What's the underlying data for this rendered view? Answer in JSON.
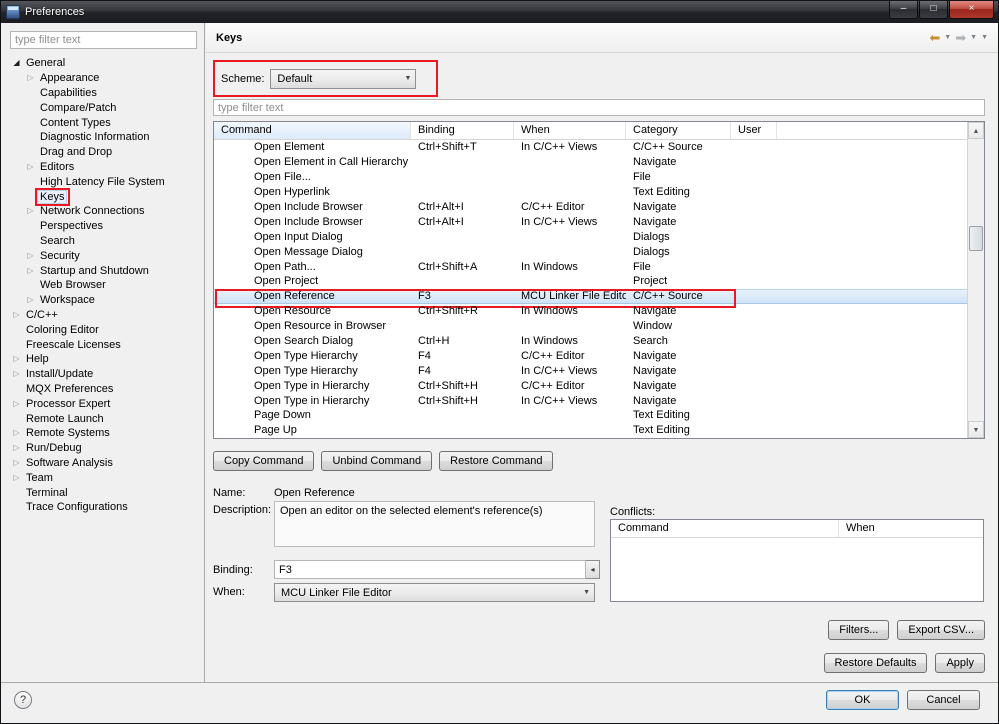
{
  "colors": {
    "annotation": "#e8191f",
    "selection": "#cfe3f7"
  },
  "window": {
    "title": "Preferences",
    "minimize": "–",
    "maximize": "□",
    "close": "×"
  },
  "icons": {
    "back": "⬅",
    "forward": "➡",
    "caret": "▼",
    "scroll_up": "▲",
    "scroll_down": "▼",
    "combo_arrow": "▼",
    "binding_more": "◂",
    "help": "?"
  },
  "sidebar": {
    "filter_placeholder": "type filter text",
    "tree": [
      {
        "label": "General",
        "level": 0,
        "arrow": "expanded"
      },
      {
        "label": "Appearance",
        "level": 1,
        "arrow": "collapsed"
      },
      {
        "label": "Capabilities",
        "level": 1,
        "arrow": "none"
      },
      {
        "label": "Compare/Patch",
        "level": 1,
        "arrow": "none"
      },
      {
        "label": "Content Types",
        "level": 1,
        "arrow": "none"
      },
      {
        "label": "Diagnostic Information",
        "level": 1,
        "arrow": "none"
      },
      {
        "label": "Drag and Drop",
        "level": 1,
        "arrow": "none"
      },
      {
        "label": "Editors",
        "level": 1,
        "arrow": "collapsed"
      },
      {
        "label": "High Latency File System",
        "level": 1,
        "arrow": "none"
      },
      {
        "label": "Keys",
        "level": 1,
        "arrow": "none",
        "selected": true,
        "annotated": true
      },
      {
        "label": "Network Connections",
        "level": 1,
        "arrow": "collapsed"
      },
      {
        "label": "Perspectives",
        "level": 1,
        "arrow": "none"
      },
      {
        "label": "Search",
        "level": 1,
        "arrow": "none"
      },
      {
        "label": "Security",
        "level": 1,
        "arrow": "collapsed"
      },
      {
        "label": "Startup and Shutdown",
        "level": 1,
        "arrow": "collapsed"
      },
      {
        "label": "Web Browser",
        "level": 1,
        "arrow": "none"
      },
      {
        "label": "Workspace",
        "level": 1,
        "arrow": "collapsed"
      },
      {
        "label": "C/C++",
        "level": 0,
        "arrow": "collapsed"
      },
      {
        "label": "Coloring Editor",
        "level": 0,
        "arrow": "none"
      },
      {
        "label": "Freescale Licenses",
        "level": 0,
        "arrow": "none"
      },
      {
        "label": "Help",
        "level": 0,
        "arrow": "collapsed"
      },
      {
        "label": "Install/Update",
        "level": 0,
        "arrow": "collapsed"
      },
      {
        "label": "MQX Preferences",
        "level": 0,
        "arrow": "none"
      },
      {
        "label": "Processor Expert",
        "level": 0,
        "arrow": "collapsed"
      },
      {
        "label": "Remote Launch",
        "level": 0,
        "arrow": "none"
      },
      {
        "label": "Remote Systems",
        "level": 0,
        "arrow": "collapsed"
      },
      {
        "label": "Run/Debug",
        "level": 0,
        "arrow": "collapsed"
      },
      {
        "label": "Software Analysis",
        "level": 0,
        "arrow": "collapsed"
      },
      {
        "label": "Team",
        "level": 0,
        "arrow": "collapsed"
      },
      {
        "label": "Terminal",
        "level": 0,
        "arrow": "none"
      },
      {
        "label": "Trace Configurations",
        "level": 0,
        "arrow": "none"
      }
    ]
  },
  "header": {
    "title": "Keys"
  },
  "scheme": {
    "label": "Scheme:",
    "value": "Default"
  },
  "keys_filter": {
    "placeholder": "type filter text"
  },
  "table": {
    "columns": [
      "Command",
      "Binding",
      "When",
      "Category",
      "User"
    ],
    "rows": [
      {
        "command": "Open Element",
        "binding": "Ctrl+Shift+T",
        "when": "In C/C++ Views",
        "category": "C/C++ Source",
        "user": ""
      },
      {
        "command": "Open Element in Call Hierarchy",
        "binding": "",
        "when": "",
        "category": "Navigate",
        "user": ""
      },
      {
        "command": "Open File...",
        "binding": "",
        "when": "",
        "category": "File",
        "user": ""
      },
      {
        "command": "Open Hyperlink",
        "binding": "",
        "when": "",
        "category": "Text Editing",
        "user": ""
      },
      {
        "command": "Open Include Browser",
        "binding": "Ctrl+Alt+I",
        "when": "C/C++ Editor",
        "category": "Navigate",
        "user": ""
      },
      {
        "command": "Open Include Browser",
        "binding": "Ctrl+Alt+I",
        "when": "In C/C++ Views",
        "category": "Navigate",
        "user": ""
      },
      {
        "command": "Open Input Dialog",
        "binding": "",
        "when": "",
        "category": "Dialogs",
        "user": ""
      },
      {
        "command": "Open Message Dialog",
        "binding": "",
        "when": "",
        "category": "Dialogs",
        "user": ""
      },
      {
        "command": "Open Path...",
        "binding": "Ctrl+Shift+A",
        "when": "In Windows",
        "category": "File",
        "user": ""
      },
      {
        "command": "Open Project",
        "binding": "",
        "when": "",
        "category": "Project",
        "user": ""
      },
      {
        "command": "Open Reference",
        "binding": "F3",
        "when": "MCU Linker File Editor",
        "category": "C/C++ Source",
        "user": "",
        "selected": true,
        "annotated": true
      },
      {
        "command": "Open Resource",
        "binding": "Ctrl+Shift+R",
        "when": "In Windows",
        "category": "Navigate",
        "user": ""
      },
      {
        "command": "Open Resource in Browser",
        "binding": "",
        "when": "",
        "category": "Window",
        "user": ""
      },
      {
        "command": "Open Search Dialog",
        "binding": "Ctrl+H",
        "when": "In Windows",
        "category": "Search",
        "user": ""
      },
      {
        "command": "Open Type Hierarchy",
        "binding": "F4",
        "when": "C/C++ Editor",
        "category": "Navigate",
        "user": ""
      },
      {
        "command": "Open Type Hierarchy",
        "binding": "F4",
        "when": "In C/C++ Views",
        "category": "Navigate",
        "user": ""
      },
      {
        "command": "Open Type in Hierarchy",
        "binding": "Ctrl+Shift+H",
        "when": "C/C++ Editor",
        "category": "Navigate",
        "user": ""
      },
      {
        "command": "Open Type in Hierarchy",
        "binding": "Ctrl+Shift+H",
        "when": "In C/C++ Views",
        "category": "Navigate",
        "user": ""
      },
      {
        "command": "Page Down",
        "binding": "",
        "when": "",
        "category": "Text Editing",
        "user": ""
      },
      {
        "command": "Page Up",
        "binding": "",
        "when": "",
        "category": "Text Editing",
        "user": ""
      }
    ]
  },
  "command_buttons": {
    "copy": "Copy Command",
    "unbind": "Unbind Command",
    "restore": "Restore Command"
  },
  "details": {
    "name_label": "Name:",
    "name_value": "Open Reference",
    "description_label": "Description:",
    "description_value": "Open an editor on the selected element's reference(s)",
    "binding_label": "Binding:",
    "binding_value": "F3",
    "when_label": "When:",
    "when_value": "MCU Linker File Editor"
  },
  "conflicts": {
    "label": "Conflicts:",
    "columns": [
      "Command",
      "When"
    ]
  },
  "action_buttons": {
    "filters": "Filters...",
    "export_csv": "Export CSV...",
    "restore_defaults": "Restore Defaults",
    "apply": "Apply"
  },
  "footer": {
    "ok": "OK",
    "cancel": "Cancel"
  }
}
